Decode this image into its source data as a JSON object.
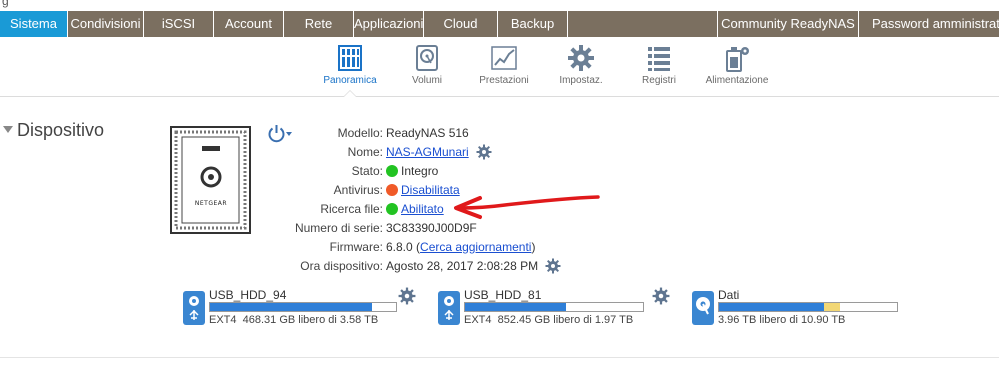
{
  "window": {
    "cropped_title_glyph": "g"
  },
  "mainnav": {
    "tabs": [
      {
        "label": "Sistema",
        "active": true
      },
      {
        "label": "Condivisioni"
      },
      {
        "label": "iSCSI"
      },
      {
        "label": "Account"
      },
      {
        "label": "Rete"
      },
      {
        "label": "Applicazioni"
      },
      {
        "label": "Cloud"
      },
      {
        "label": "Backup"
      },
      {
        "label": "Community ReadyNAS"
      },
      {
        "label": "Password amministratore"
      }
    ]
  },
  "subnav": {
    "items": [
      {
        "label": "Panoramica",
        "icon": "overview-icon",
        "active": true
      },
      {
        "label": "Volumi",
        "icon": "disk-icon"
      },
      {
        "label": "Prestazioni",
        "icon": "performance-icon"
      },
      {
        "label": "Impostaz.",
        "icon": "gear-icon"
      },
      {
        "label": "Registri",
        "icon": "list-icon"
      },
      {
        "label": "Alimentazione",
        "icon": "power-settings-icon"
      }
    ]
  },
  "section": {
    "title": "Dispositivo"
  },
  "device": {
    "brand": "NETGEAR",
    "model_label": "Modello:",
    "model": "ReadyNAS 516",
    "name_label": "Nome:",
    "name": "NAS-AGMunari",
    "status_label": "Stato:",
    "status": "Integro",
    "status_color": "#22c322",
    "antivirus_label": "Antivirus:",
    "antivirus": "Disabilitata",
    "antivirus_color": "#f05a28",
    "search_label": "Ricerca file:",
    "search": "Abilitato",
    "search_color": "#22c322",
    "serial_label": "Numero di serie:",
    "serial": "3C83390J00D9F",
    "firmware_label": "Firmware:",
    "firmware": "6.8.0",
    "firmware_open": "(",
    "firmware_link": "Cerca aggiornamenti",
    "firmware_close": ")",
    "time_label": "Ora dispositivo:",
    "time": "Agosto 28, 2017 2:08:28 PM"
  },
  "volumes": [
    {
      "name": "USB_HDD_94",
      "fs": "EXT4",
      "info": "468.31 GB libero di 3.58 TB",
      "used": 0.87
    },
    {
      "name": "USB_HDD_81",
      "fs": "EXT4",
      "info": "852.45 GB libero di 1.97 TB",
      "used": 0.57
    },
    {
      "name": "Dati",
      "fs": "",
      "info": "3.96 TB libero di 10.90 TB",
      "used": 0.59,
      "reserved": 0.09
    }
  ],
  "colors": {
    "accent": "#1a9ad6",
    "nav": "#7b6f60",
    "link": "#1a4fd1",
    "annotation": "#e0191b"
  }
}
